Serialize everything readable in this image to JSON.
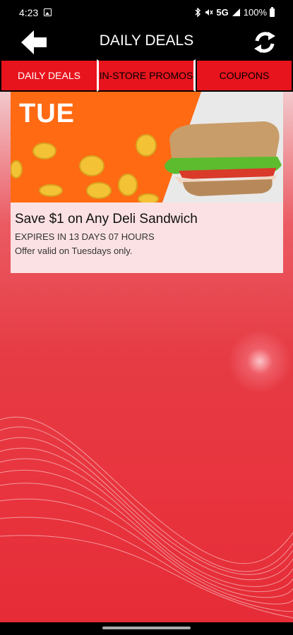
{
  "status_bar": {
    "time": "4:23",
    "network": "5G",
    "battery": "100%",
    "icons": [
      "gallery-icon",
      "bluetooth-icon",
      "mute-icon",
      "signal-icon",
      "battery-icon"
    ]
  },
  "app_bar": {
    "title": "DAILY DEALS",
    "back_icon": "back-arrow-icon",
    "refresh_icon": "refresh-icon"
  },
  "tabs": [
    {
      "label": "DAILY DEALS",
      "active": true
    },
    {
      "label": "IN-STORE PROMOS",
      "active": false
    },
    {
      "label": "COUPONS",
      "active": false
    }
  ],
  "deal": {
    "day": "TUE",
    "title": "Save $1 on Any Deli Sandwich",
    "expiry": "EXPIRES IN 13 DAYS 07 HOURS",
    "note": "Offer valid on Tuesdays only."
  },
  "colors": {
    "brand_red": "#e8141d",
    "banner_orange": "#ff6a13",
    "coin_gold": "#f3c335"
  }
}
